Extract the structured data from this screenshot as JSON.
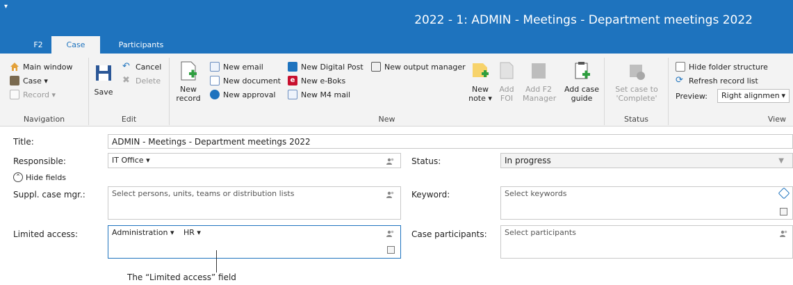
{
  "window": {
    "qat_glyph": "▾",
    "title": "2022 - 1: ADMIN - Meetings - Department meetings 2022"
  },
  "tabs": [
    {
      "label": "F2"
    },
    {
      "label": "Case"
    },
    {
      "label": "Participants"
    }
  ],
  "ribbon": {
    "navigation": {
      "label": "Navigation",
      "main_window": "Main window",
      "case": "Case ▾",
      "record": "Record ▾"
    },
    "edit": {
      "label": "Edit",
      "save": "Save",
      "cancel": "Cancel",
      "delete": "Delete"
    },
    "new": {
      "label": "New",
      "new_record_1": "New",
      "new_record_2": "record",
      "new_email": "New email",
      "new_document": "New document",
      "new_approval": "New approval",
      "new_digital_post": "New Digital Post",
      "new_eboks": "New e-Boks",
      "new_m4": "New M4 mail",
      "new_output_manager": "New output manager",
      "new_note_1": "New",
      "new_note_2": "note ▾",
      "add_foi_1": "Add",
      "add_foi_2": "FOI",
      "add_f2_1": "Add F2",
      "add_f2_2": "Manager",
      "add_guide_1": "Add case",
      "add_guide_2": "guide"
    },
    "status": {
      "label": "Status",
      "set_1": "Set case to",
      "set_2": "'Complete'"
    },
    "view": {
      "label": "View",
      "hide_folder": "Hide folder structure",
      "refresh": "Refresh record list",
      "preview_label": "Preview:",
      "preview_value": "Right alignmen",
      "preview_arrow": "▾"
    }
  },
  "form": {
    "title_label": "Title:",
    "title_value": "ADMIN - Meetings - Department meetings 2022",
    "responsible_label": "Responsible:",
    "responsible_value": "IT Office ▾",
    "status_label": "Status:",
    "status_value": "In progress",
    "hide_fields": "Hide fields",
    "suppl_label": "Suppl. case mgr.:",
    "suppl_placeholder": "Select persons, units, teams or distribution lists",
    "keyword_label": "Keyword:",
    "keyword_placeholder": "Select keywords",
    "limited_label": "Limited access:",
    "limited_values": [
      "Administration ▾",
      "HR ▾"
    ],
    "participants_label": "Case participants:",
    "participants_placeholder": "Select participants"
  },
  "annotation": {
    "callout": "The “Limited access” field"
  },
  "colors": {
    "accent": "#1e73be",
    "ribbon_bg": "#f3f3f3"
  }
}
